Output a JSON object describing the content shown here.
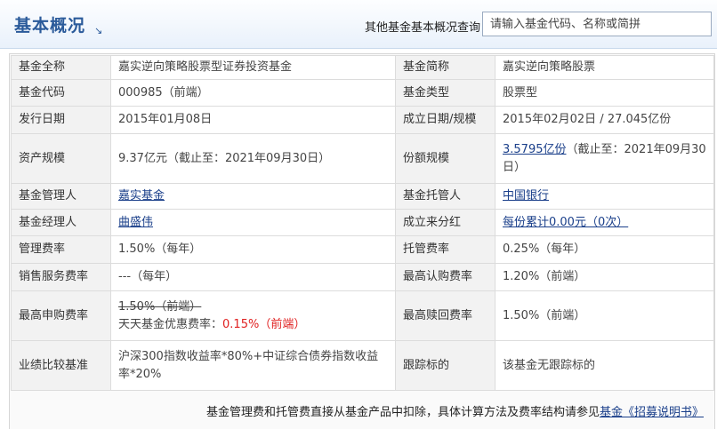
{
  "header": {
    "title": "基本概况",
    "title_mark": "↘",
    "search_label": "其他基金基本概况查询：",
    "search_placeholder": "请输入基金代码、名称或简拼"
  },
  "rows": [
    {
      "l1": "基金全称",
      "v1": "嘉实逆向策略股票型证券投资基金",
      "l2": "基金简称",
      "v2": "嘉实逆向策略股票"
    },
    {
      "l1": "基金代码",
      "v1": "000985（前端）",
      "l2": "基金类型",
      "v2": "股票型"
    },
    {
      "l1": "发行日期",
      "v1": "2015年01月08日",
      "l2": "成立日期/规模",
      "v2": "2015年02月02日 / 27.045亿份"
    },
    {
      "l1": "资产规模",
      "v1": "9.37亿元（截止至：2021年09月30日）",
      "l2": "份额规模",
      "v2_link": "3.5795亿份",
      "v2_rest": "（截止至：2021年09月30日）"
    },
    {
      "l1": "基金管理人",
      "v1_link": "嘉实基金",
      "l2": "基金托管人",
      "v2_link": "中国银行"
    },
    {
      "l1": "基金经理人",
      "v1_link": "曲盛伟",
      "l2": "成立来分红",
      "v2_link": "每份累计0.00元（0次）"
    },
    {
      "l1": "管理费率",
      "v1": "1.50%（每年）",
      "l2": "托管费率",
      "v2": "0.25%（每年）"
    },
    {
      "l1": "销售服务费率",
      "v1": "---（每年）",
      "l2": "最高认购费率",
      "v2": "1.20%（前端）"
    },
    {
      "l1": "最高申购费率",
      "v1_strike": "1.50%（前端）",
      "v1_discount_label": "天天基金优惠费率：",
      "v1_discount_value": "0.15%（前端）",
      "l2": "最高赎回费率",
      "v2": "1.50%（前端）"
    },
    {
      "l1": "业绩比较基准",
      "v1": "沪深300指数收益率*80%+中证综合债券指数收益率*20%",
      "l2": "跟踪标的",
      "v2": "该基金无跟踪标的"
    }
  ],
  "footer": {
    "text": "基金管理费和托管费直接从基金产品中扣除，具体计算方法及费率结构请参见",
    "link": "基金《招募说明书》"
  },
  "colors": {
    "title": "#2a5a9a",
    "link": "#1a3f8a",
    "discount": "#e02020"
  }
}
